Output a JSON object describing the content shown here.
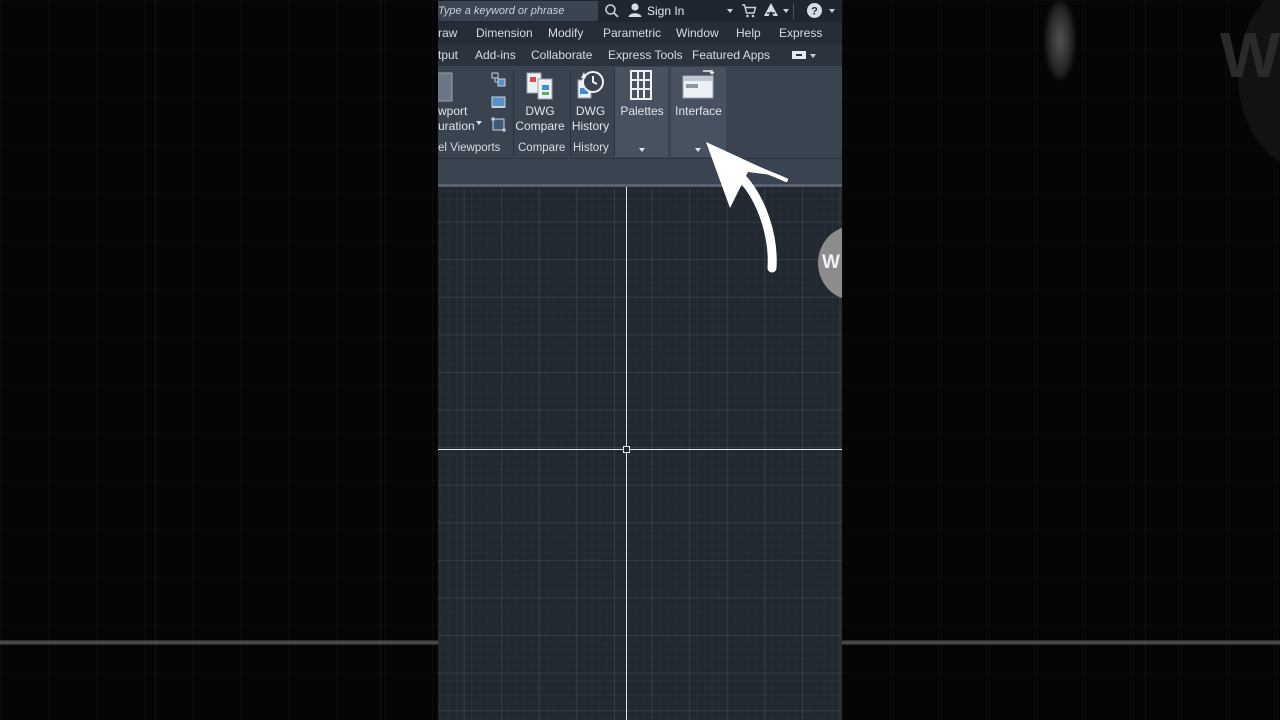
{
  "search": {
    "placeholder": "Type a keyword or phrase"
  },
  "titlebar": {
    "sign_in_label": "Sign In",
    "icons": [
      "search-icon",
      "user-icon",
      "cart-icon",
      "autodesk-icon",
      "help-icon"
    ]
  },
  "menubar": {
    "items": [
      "raw",
      "Dimension",
      "Modify",
      "Parametric",
      "Window",
      "Help",
      "Express"
    ]
  },
  "tabs": {
    "items": [
      "tput",
      "Add-ins",
      "Collaborate",
      "Express Tools",
      "Featured Apps"
    ]
  },
  "ribbon": {
    "viewport_config": {
      "line1": "wport",
      "line2": "uration"
    },
    "dwg_compare": {
      "line1": "DWG",
      "line2": "Compare"
    },
    "dwg_history": {
      "line1": "DWG",
      "line2": "History"
    },
    "palettes": {
      "label": "Palettes"
    },
    "interface": {
      "label": "Interface"
    },
    "panels": {
      "model_viewports": "el Viewports",
      "compare": "Compare",
      "history": "History"
    }
  },
  "watermark": {
    "viewport_letter": "W",
    "background_letter": "W"
  },
  "colors": {
    "ribbon_bg": "#3a4350",
    "menubar_bg": "#252d38",
    "canvas_bg": "#212830",
    "highlight_panel": "#47515f",
    "axis": "#e8e8e8"
  }
}
